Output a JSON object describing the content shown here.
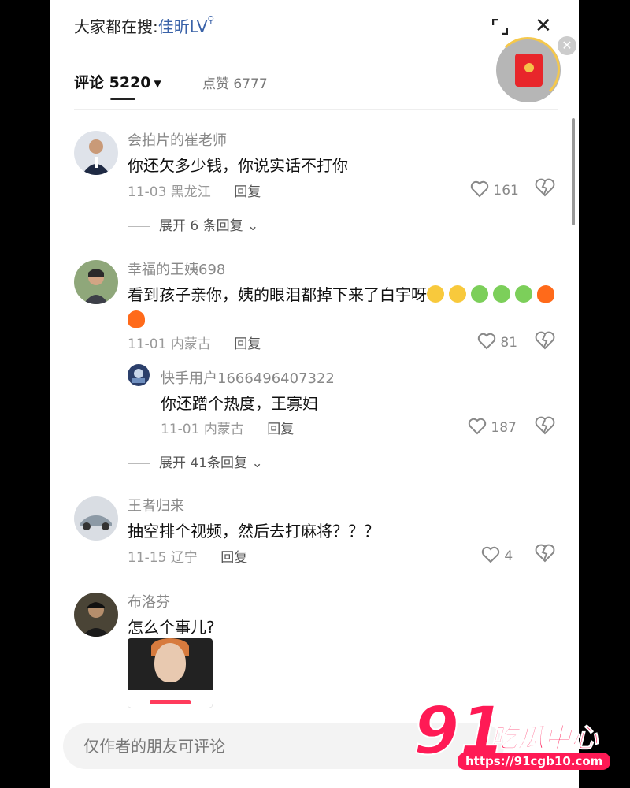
{
  "header": {
    "prefix": "大家都在搜:",
    "search_term": "佳昕LV",
    "search_icon": "search-icon"
  },
  "tabs": {
    "comments": "评论 5220",
    "likes": "点赞 6777"
  },
  "comments": [
    {
      "user": "会拍片的崔老师",
      "text": "你还欠多少钱，你说实话不打你",
      "date": "11-03",
      "location": "黑龙江",
      "reply": "回复",
      "likes": "161",
      "expand": "展开 6 条回复"
    },
    {
      "user": "幸福的王姨698",
      "text": "看到孩子亲你，姨的眼泪都掉下来了白宇呀",
      "date": "11-01",
      "location": "内蒙古",
      "reply": "回复",
      "likes": "81",
      "expand": "展开 41条回复",
      "sub_reply": {
        "user": "快手用户1666496407322",
        "text": "你还蹭个热度，王寡妇",
        "date": "11-01",
        "location": "内蒙古",
        "reply": "回复",
        "likes": "187"
      }
    },
    {
      "user": "王者归来",
      "text": "抽空排个视频，然后去打麻将？？？",
      "date": "11-15",
      "location": "辽宁",
      "reply": "回复",
      "likes": "4"
    },
    {
      "user": "布洛芬",
      "text": "怎么个事儿?"
    }
  ],
  "input": {
    "placeholder": "仅作者的朋友可评论"
  },
  "watermark": {
    "number": "91",
    "name": "吃瓜中心",
    "url": "https://91cgb10.com"
  },
  "colors": {
    "link": "#3a62a8",
    "watermark": "#ff1a55"
  }
}
